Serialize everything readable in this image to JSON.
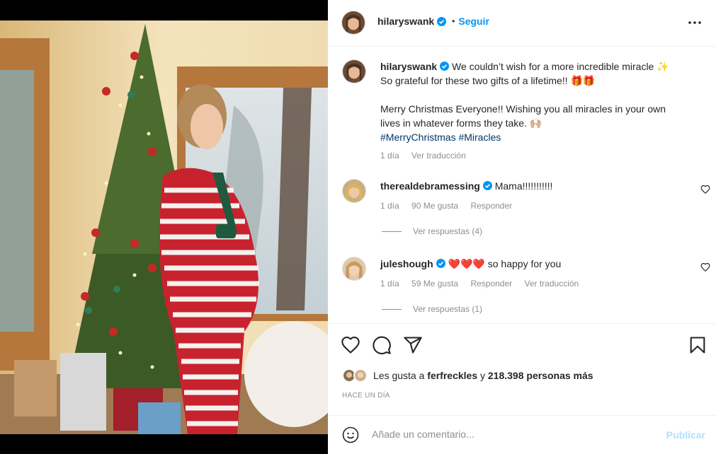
{
  "post": {
    "photo_alt": "",
    "author": {
      "username": "hilaryswank",
      "verified_icon": "verified-badge-icon",
      "separator": "•",
      "follow_label": "Seguir"
    },
    "more_icon": "more-options-icon",
    "caption": {
      "username": "hilaryswank",
      "line1": "We couldn’t wish for a more incredible miracle ✨",
      "line2": "So grateful for these two gifts of a lifetime!! 🎁🎁",
      "line3": "Merry Christmas Everyone!! Wishing you all miracles in your own",
      "line4": "lives in whatever forms they take. 🙌🏼",
      "hashtags": "#MerryChristmas #Miracles",
      "age": "1 día",
      "translate": "Ver traducción"
    },
    "comments": [
      {
        "username": "therealdebramessing",
        "text": "Mama!!!!!!!!!!!",
        "age": "1 día",
        "likes": "90 Me gusta",
        "reply": "Responder",
        "translate": "",
        "replies_label": "Ver respuestas (4)"
      },
      {
        "username": "juleshough",
        "text": "❤️❤️❤️ so happy for you",
        "age": "1 día",
        "likes": "59 Me gusta",
        "reply": "Responder",
        "translate": "Ver traducción",
        "replies_label": "Ver respuestas (1)"
      }
    ],
    "likes": {
      "prefix": "Les gusta a",
      "user": "ferfreckles",
      "connector": "y",
      "others": "218.398 personas más"
    },
    "timestamp": "HACE UN DÍA",
    "add_comment": {
      "placeholder": "Añade un comentario...",
      "publish_label": "Publicar"
    }
  },
  "colors": {
    "accent": "#0095f6",
    "publish_disabled": "#b2dffc",
    "secondary_text": "#8e8e8e",
    "hashtag": "#00376b",
    "heart": "#ed4956"
  }
}
